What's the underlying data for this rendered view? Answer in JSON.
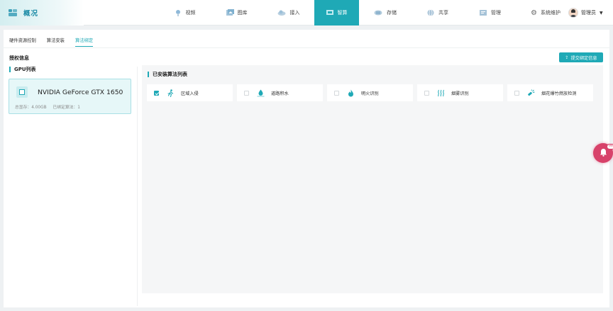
{
  "brand": {
    "title": "概况"
  },
  "nav": {
    "items": [
      {
        "label": "视频",
        "icon": "camera-pin-icon",
        "active": false
      },
      {
        "label": "图库",
        "icon": "gallery-icon",
        "active": false
      },
      {
        "label": "接入",
        "icon": "cloud-link-icon",
        "active": false
      },
      {
        "label": "智算",
        "icon": "compute-icon",
        "active": true
      },
      {
        "label": "存储",
        "icon": "storage-icon",
        "active": false
      },
      {
        "label": "共享",
        "icon": "share-globe-icon",
        "active": false
      },
      {
        "label": "管理",
        "icon": "manage-icon",
        "active": false
      }
    ],
    "system_label": "系统维护",
    "user_label": "管理员"
  },
  "subtabs": {
    "items": [
      "硬件资源控制",
      "算法安装",
      "算法绑定"
    ],
    "active_index": 2
  },
  "auth": {
    "title": "授权信息",
    "submit_label": "提交绑定信息"
  },
  "gpu": {
    "title": "GPU列表",
    "name": "NVIDIA GeForce GTX 1650",
    "memory": "总显存：4.00GB",
    "bound": "已绑定算法：1"
  },
  "algorithms": {
    "title": "已安装算法列表",
    "items": [
      {
        "label": "区域入侵",
        "icon": "running-person-icon",
        "checked": true
      },
      {
        "label": "道路积水",
        "icon": "water-drop-icon",
        "checked": false
      },
      {
        "label": "明火识别",
        "icon": "fire-icon",
        "checked": false
      },
      {
        "label": "烟雾识别",
        "icon": "smoke-icon",
        "checked": false
      },
      {
        "label": "烟花爆竹燃放检测",
        "icon": "firework-icon",
        "checked": false
      }
    ]
  },
  "notification": {
    "badge": "99"
  },
  "colors": {
    "accent": "#1fa9b6",
    "alert": "#d8426a"
  }
}
